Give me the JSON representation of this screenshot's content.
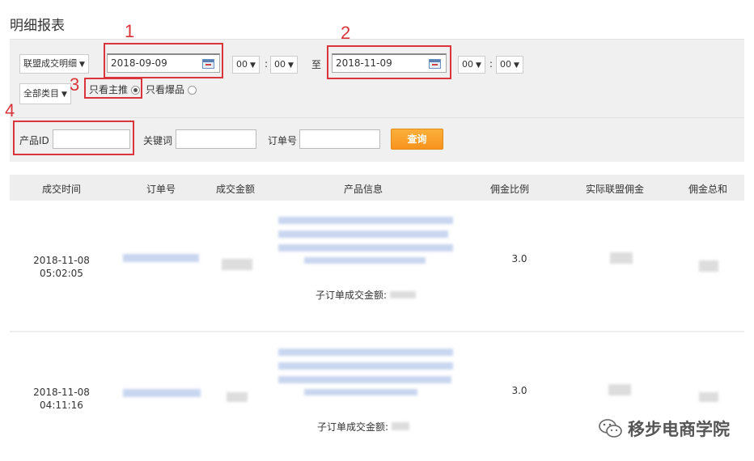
{
  "page_title": "明细报表",
  "filters": {
    "report_type": "联盟成交明细",
    "start_date": "2018-09-09",
    "start_hour": "00",
    "start_min": "00",
    "to_label": "至",
    "end_date": "2018-11-09",
    "end_hour": "00",
    "end_min": "00",
    "colon": ":",
    "category": "全部类目",
    "radio_main": "只看主推",
    "radio_hot": "只看爆品",
    "product_id_label": "产品ID",
    "keyword_label": "关键词",
    "order_no_label": "订单号",
    "query_button": "查询"
  },
  "annotations": [
    "1",
    "2",
    "3",
    "4"
  ],
  "table": {
    "headers": [
      "成交时间",
      "订单号",
      "成交金额",
      "产品信息",
      "佣金比例",
      "实际联盟佣金",
      "佣金总和"
    ],
    "rows": [
      {
        "time": "2018-11-08 05:02:05",
        "commission_rate": "3.0",
        "sub_order_label": "子订单成交金额:"
      },
      {
        "time": "2018-11-08 04:11:16",
        "commission_rate": "3.0",
        "sub_order_label": "子订单成交金额:"
      }
    ]
  },
  "watermark": "移步电商学院"
}
